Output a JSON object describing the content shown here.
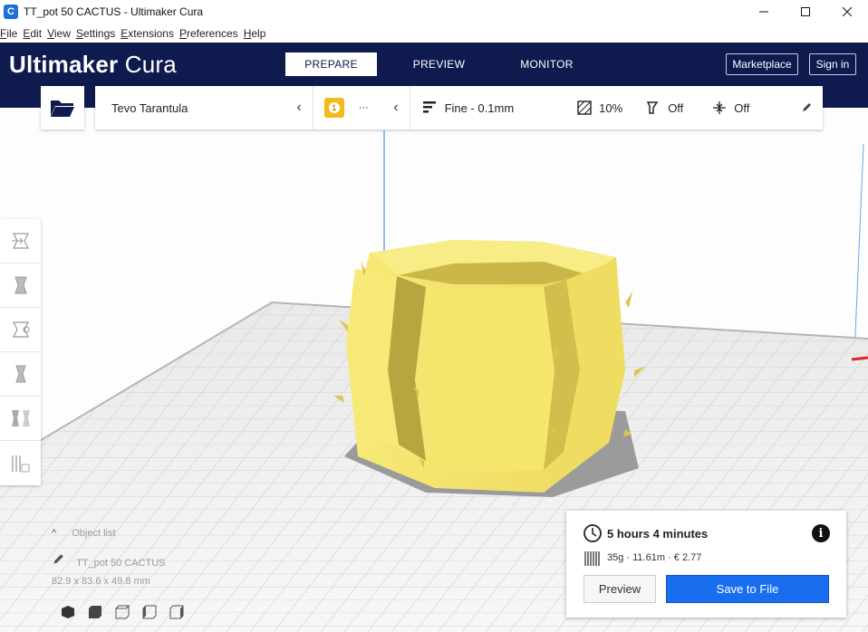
{
  "window": {
    "title": "TT_pot 50 CACTUS - Ultimaker Cura",
    "app_icon": "cura-app-icon",
    "controls": [
      "minimize",
      "maximize",
      "close"
    ]
  },
  "menu": [
    "File",
    "Edit",
    "View",
    "Settings",
    "Extensions",
    "Preferences",
    "Help"
  ],
  "header": {
    "brand_bold": "Ultimaker",
    "brand_light": "Cura",
    "tabs": [
      {
        "label": "PREPARE",
        "active": true
      },
      {
        "label": "PREVIEW",
        "active": false
      },
      {
        "label": "MONITOR",
        "active": false
      }
    ],
    "marketplace_label": "Marketplace",
    "signin_label": "Sign in",
    "background": "#0f1a4e"
  },
  "printer_bar": {
    "printer_name": "Tevo Tarantula",
    "extruder_number": "1",
    "extruder_material": "···",
    "profile": "Fine - 0.1mm",
    "infill": "10%",
    "support": "Off",
    "adhesion": "Off"
  },
  "object": {
    "list_label": "Object list",
    "name": "TT_pot 50 CACTUS",
    "dimensions": "82.9 x 83.6 x 49.8 mm",
    "model_color": "#f5e86a"
  },
  "print_info": {
    "time": "5 hours 4 minutes",
    "material": "35g · 11.61m · € 2.77",
    "preview_label": "Preview",
    "save_label": "Save to File",
    "accent": "#196ef0"
  },
  "tools": [
    "move-icon",
    "scale-icon",
    "rotate-icon",
    "mirror-icon",
    "per-model-settings-icon",
    "support-blocker-icon"
  ],
  "view_cubes": [
    "3d-view-icon",
    "front-view-icon",
    "top-view-icon",
    "left-view-icon",
    "right-view-icon"
  ]
}
